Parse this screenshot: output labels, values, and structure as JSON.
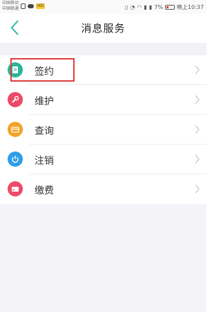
{
  "status_bar": {
    "carrier1": "中国移动",
    "carrier2": "中国联通",
    "battery": "7%",
    "time": "晚上10:37",
    "accent_color": "#e33"
  },
  "nav": {
    "back_icon": "chevron-left-icon",
    "title": "消息服务",
    "accent_color": "#2ab5a5"
  },
  "items": [
    {
      "label": "签约",
      "icon": "sign-icon",
      "color": "#2bb59a"
    },
    {
      "label": "维护",
      "icon": "wrench-icon",
      "color": "#ec4b67"
    },
    {
      "label": "查询",
      "icon": "card-icon",
      "color": "#f1a327"
    },
    {
      "label": "注销",
      "icon": "power-icon",
      "color": "#2f9ee8"
    },
    {
      "label": "缴费",
      "icon": "payment-card-icon",
      "color": "#ec4b67"
    }
  ]
}
